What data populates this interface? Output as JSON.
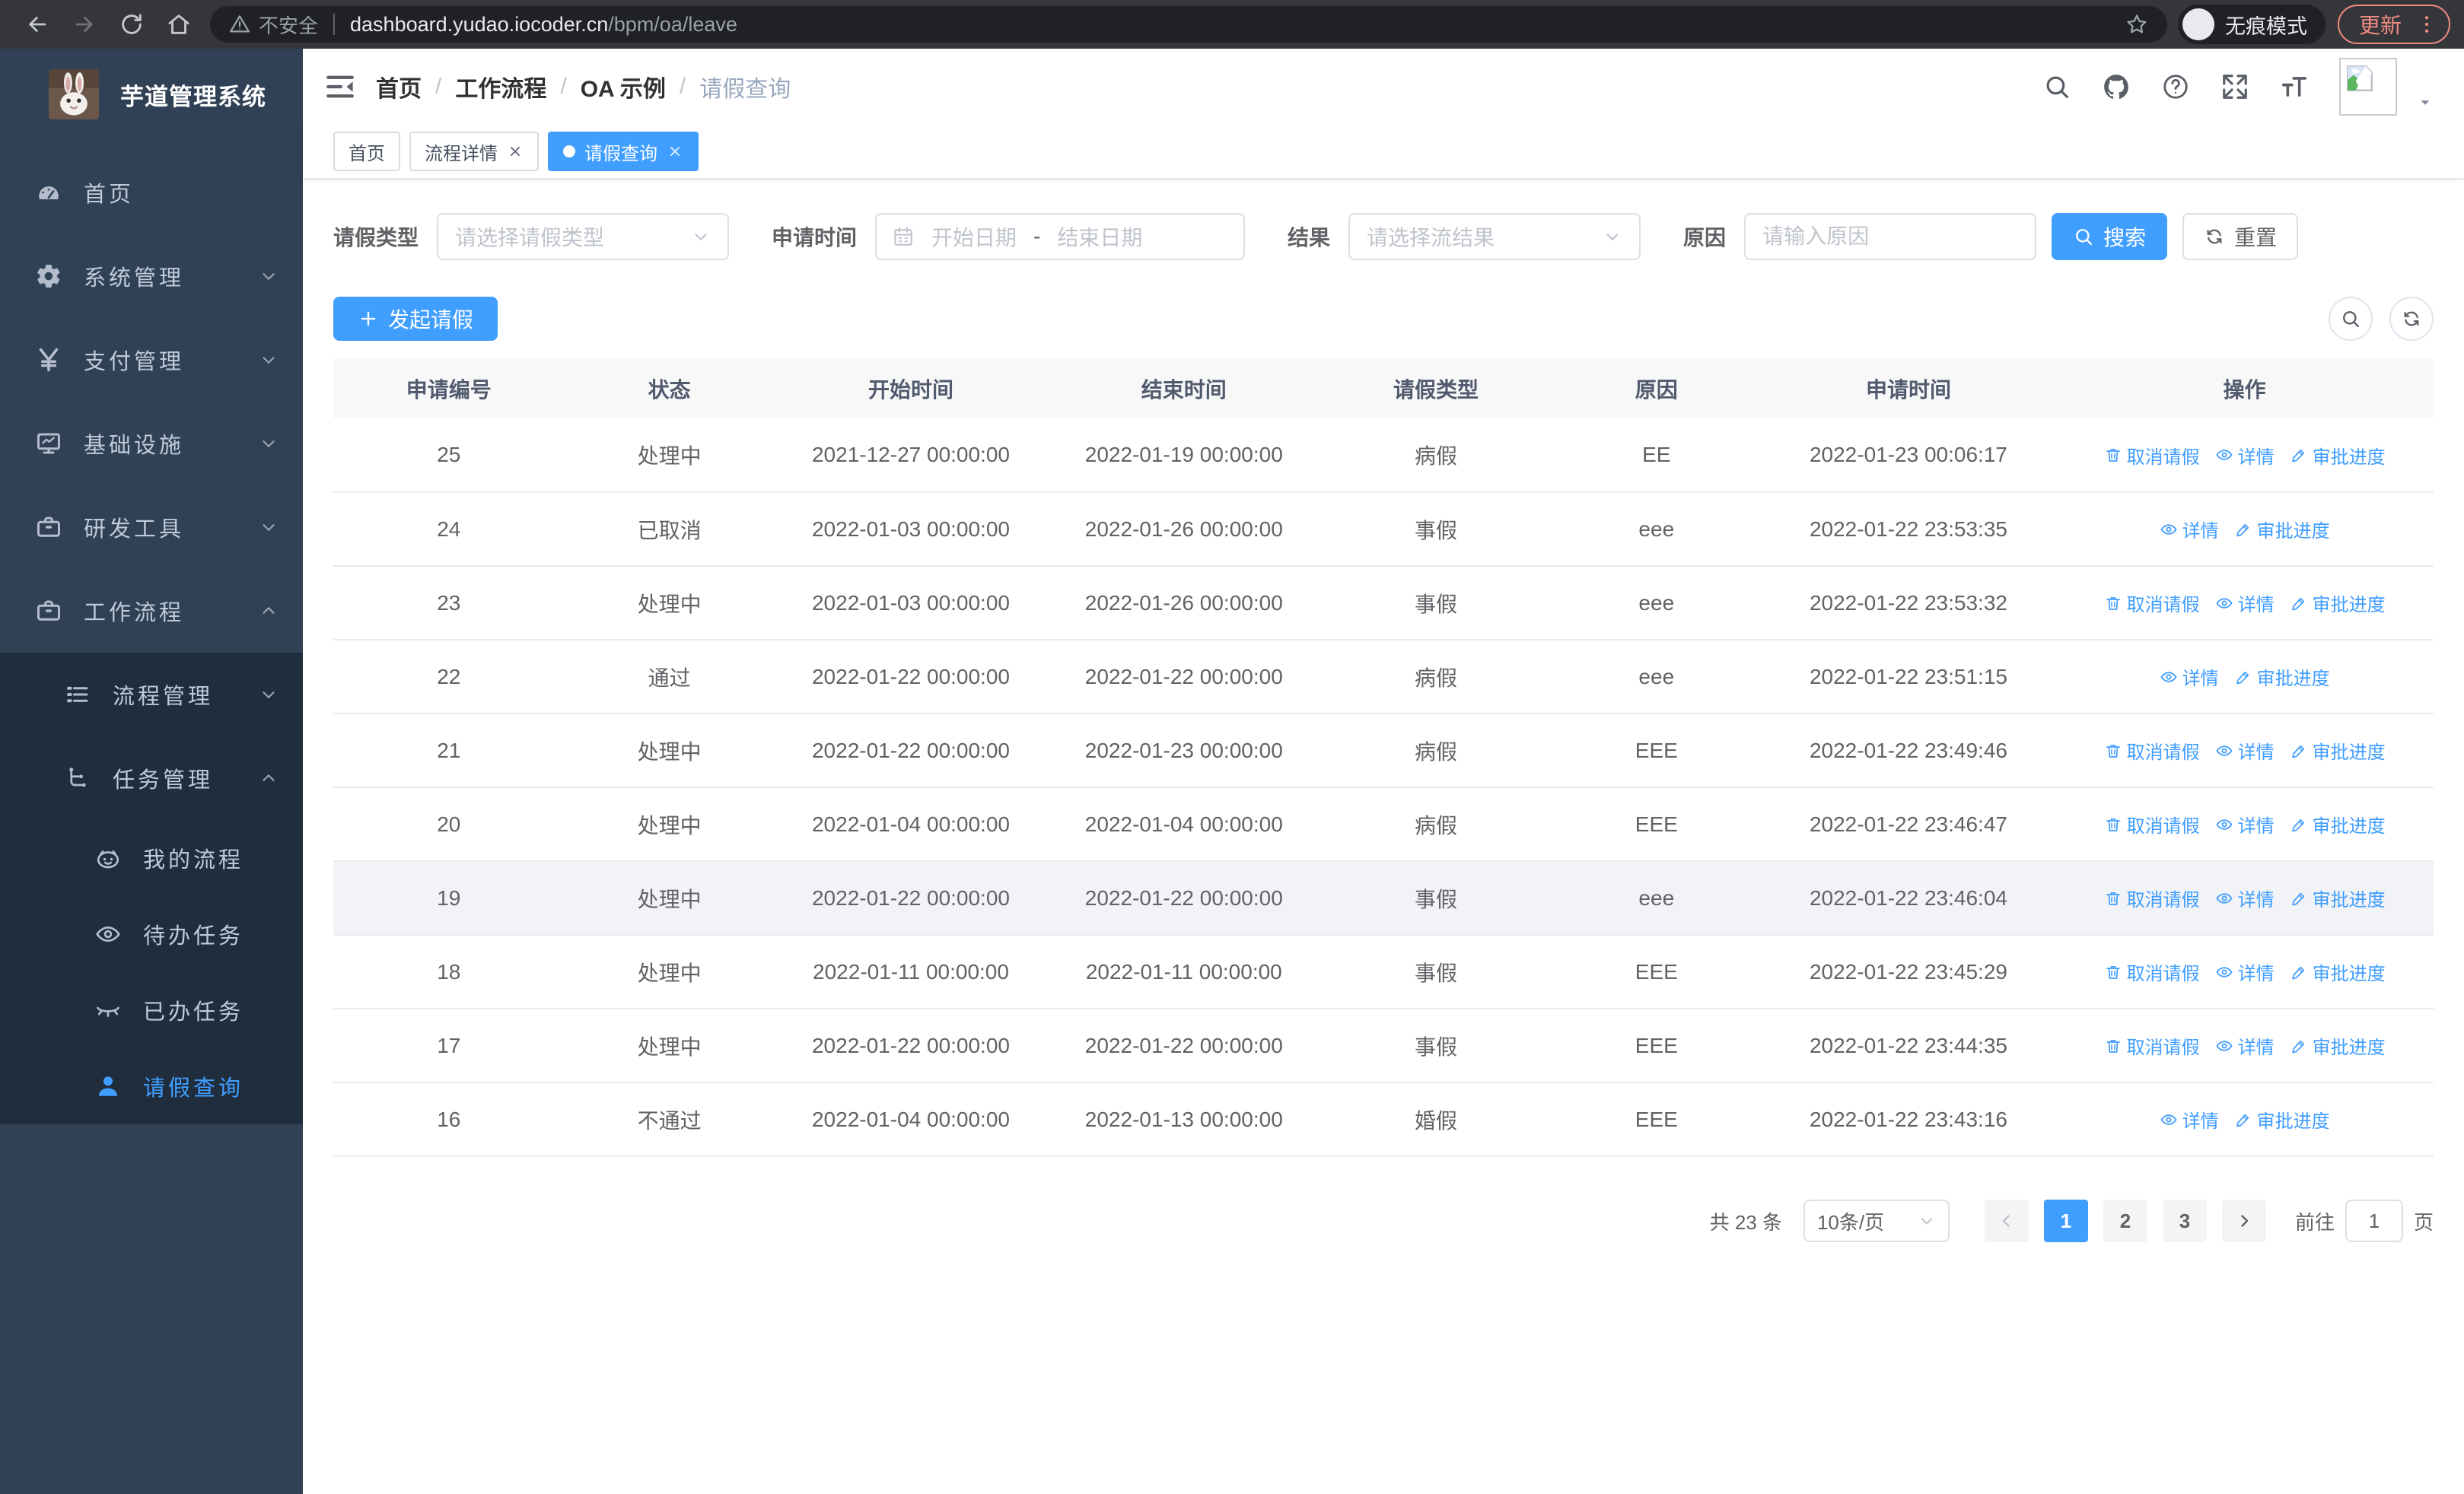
{
  "browser": {
    "security_label": "不安全",
    "url_host": "dashboard.yudao.iocoder.cn",
    "url_path": "/bpm/oa/leave",
    "incognito_label": "无痕模式",
    "update_label": "更新"
  },
  "sidebar": {
    "title": "芋道管理系统",
    "items": [
      {
        "label": "首页",
        "icon": "dashboard-icon",
        "level": 1,
        "chevron": null,
        "submenu": false,
        "active": false
      },
      {
        "label": "系统管理",
        "icon": "gear-icon",
        "level": 1,
        "chevron": "down",
        "submenu": false,
        "active": false
      },
      {
        "label": "支付管理",
        "icon": "yen-icon",
        "level": 1,
        "chevron": "down",
        "submenu": false,
        "active": false
      },
      {
        "label": "基础设施",
        "icon": "monitor-icon",
        "level": 1,
        "chevron": "down",
        "submenu": false,
        "active": false
      },
      {
        "label": "研发工具",
        "icon": "briefcase-icon",
        "level": 1,
        "chevron": "down",
        "submenu": false,
        "active": false
      },
      {
        "label": "工作流程",
        "icon": "briefcase-icon",
        "level": 1,
        "chevron": "up",
        "submenu": false,
        "active": false
      },
      {
        "label": "流程管理",
        "icon": "list-icon",
        "level": 2,
        "chevron": "down",
        "submenu": true,
        "active": false
      },
      {
        "label": "任务管理",
        "icon": "tree-icon",
        "level": 2,
        "chevron": "up",
        "submenu": true,
        "active": false
      },
      {
        "label": "我的流程",
        "icon": "robot-icon",
        "level": 3,
        "chevron": null,
        "submenu": true,
        "active": false
      },
      {
        "label": "待办任务",
        "icon": "eye-icon",
        "level": 3,
        "chevron": null,
        "submenu": true,
        "active": false
      },
      {
        "label": "已办任务",
        "icon": "eye-closed-icon",
        "level": 3,
        "chevron": null,
        "submenu": true,
        "active": false
      },
      {
        "label": "请假查询",
        "icon": "user-icon",
        "level": 3,
        "chevron": null,
        "submenu": true,
        "active": true
      }
    ]
  },
  "breadcrumb": {
    "items": [
      "首页",
      "工作流程",
      "OA 示例",
      "请假查询"
    ]
  },
  "tags_view": {
    "tabs": [
      {
        "label": "首页",
        "closable": false,
        "active": false
      },
      {
        "label": "流程详情",
        "closable": true,
        "active": false
      },
      {
        "label": "请假查询",
        "closable": true,
        "active": true
      }
    ]
  },
  "filters": {
    "leave_type": {
      "label": "请假类型",
      "placeholder": "请选择请假类型"
    },
    "apply_time": {
      "label": "申请时间",
      "start_placeholder": "开始日期",
      "separator": "-",
      "end_placeholder": "结束日期"
    },
    "result": {
      "label": "结果",
      "placeholder": "请选择流结果"
    },
    "reason": {
      "label": "原因",
      "placeholder": "请输入原因"
    },
    "search_label": "搜索",
    "reset_label": "重置"
  },
  "toolbar": {
    "create_label": "发起请假"
  },
  "table": {
    "columns": [
      "申请编号",
      "状态",
      "开始时间",
      "结束时间",
      "请假类型",
      "原因",
      "申请时间",
      "操作"
    ],
    "action_labels": {
      "cancel": "取消请假",
      "detail": "详情",
      "progress": "审批进度"
    },
    "rows": [
      {
        "id": "25",
        "status": "处理中",
        "start": "2021-12-27 00:00:00",
        "end": "2022-01-19 00:00:00",
        "type": "病假",
        "reason": "EE",
        "apply_time": "2022-01-23 00:06:17",
        "actions": [
          "cancel",
          "detail",
          "progress"
        ],
        "highlighted": false
      },
      {
        "id": "24",
        "status": "已取消",
        "start": "2022-01-03 00:00:00",
        "end": "2022-01-26 00:00:00",
        "type": "事假",
        "reason": "eee",
        "apply_time": "2022-01-22 23:53:35",
        "actions": [
          "detail",
          "progress"
        ],
        "highlighted": false
      },
      {
        "id": "23",
        "status": "处理中",
        "start": "2022-01-03 00:00:00",
        "end": "2022-01-26 00:00:00",
        "type": "事假",
        "reason": "eee",
        "apply_time": "2022-01-22 23:53:32",
        "actions": [
          "cancel",
          "detail",
          "progress"
        ],
        "highlighted": false
      },
      {
        "id": "22",
        "status": "通过",
        "start": "2022-01-22 00:00:00",
        "end": "2022-01-22 00:00:00",
        "type": "病假",
        "reason": "eee",
        "apply_time": "2022-01-22 23:51:15",
        "actions": [
          "detail",
          "progress"
        ],
        "highlighted": false
      },
      {
        "id": "21",
        "status": "处理中",
        "start": "2022-01-22 00:00:00",
        "end": "2022-01-23 00:00:00",
        "type": "病假",
        "reason": "EEE",
        "apply_time": "2022-01-22 23:49:46",
        "actions": [
          "cancel",
          "detail",
          "progress"
        ],
        "highlighted": false
      },
      {
        "id": "20",
        "status": "处理中",
        "start": "2022-01-04 00:00:00",
        "end": "2022-01-04 00:00:00",
        "type": "病假",
        "reason": "EEE",
        "apply_time": "2022-01-22 23:46:47",
        "actions": [
          "cancel",
          "detail",
          "progress"
        ],
        "highlighted": false
      },
      {
        "id": "19",
        "status": "处理中",
        "start": "2022-01-22 00:00:00",
        "end": "2022-01-22 00:00:00",
        "type": "事假",
        "reason": "eee",
        "apply_time": "2022-01-22 23:46:04",
        "actions": [
          "cancel",
          "detail",
          "progress"
        ],
        "highlighted": true
      },
      {
        "id": "18",
        "status": "处理中",
        "start": "2022-01-11 00:00:00",
        "end": "2022-01-11 00:00:00",
        "type": "事假",
        "reason": "EEE",
        "apply_time": "2022-01-22 23:45:29",
        "actions": [
          "cancel",
          "detail",
          "progress"
        ],
        "highlighted": false
      },
      {
        "id": "17",
        "status": "处理中",
        "start": "2022-01-22 00:00:00",
        "end": "2022-01-22 00:00:00",
        "type": "事假",
        "reason": "EEE",
        "apply_time": "2022-01-22 23:44:35",
        "actions": [
          "cancel",
          "detail",
          "progress"
        ],
        "highlighted": false
      },
      {
        "id": "16",
        "status": "不通过",
        "start": "2022-01-04 00:00:00",
        "end": "2022-01-13 00:00:00",
        "type": "婚假",
        "reason": "EEE",
        "apply_time": "2022-01-22 23:43:16",
        "actions": [
          "detail",
          "progress"
        ],
        "highlighted": false
      }
    ]
  },
  "pagination": {
    "total_label": "共 23 条",
    "page_size": "10条/页",
    "pages": [
      "1",
      "2",
      "3"
    ],
    "active_page": "1",
    "goto_label": "前往",
    "goto_value": "1",
    "goto_suffix": "页"
  },
  "colors": {
    "primary": "#409eff",
    "sidebar_bg": "#304156",
    "submenu_bg": "#1f2d3d",
    "update_accent": "#f28b82"
  }
}
